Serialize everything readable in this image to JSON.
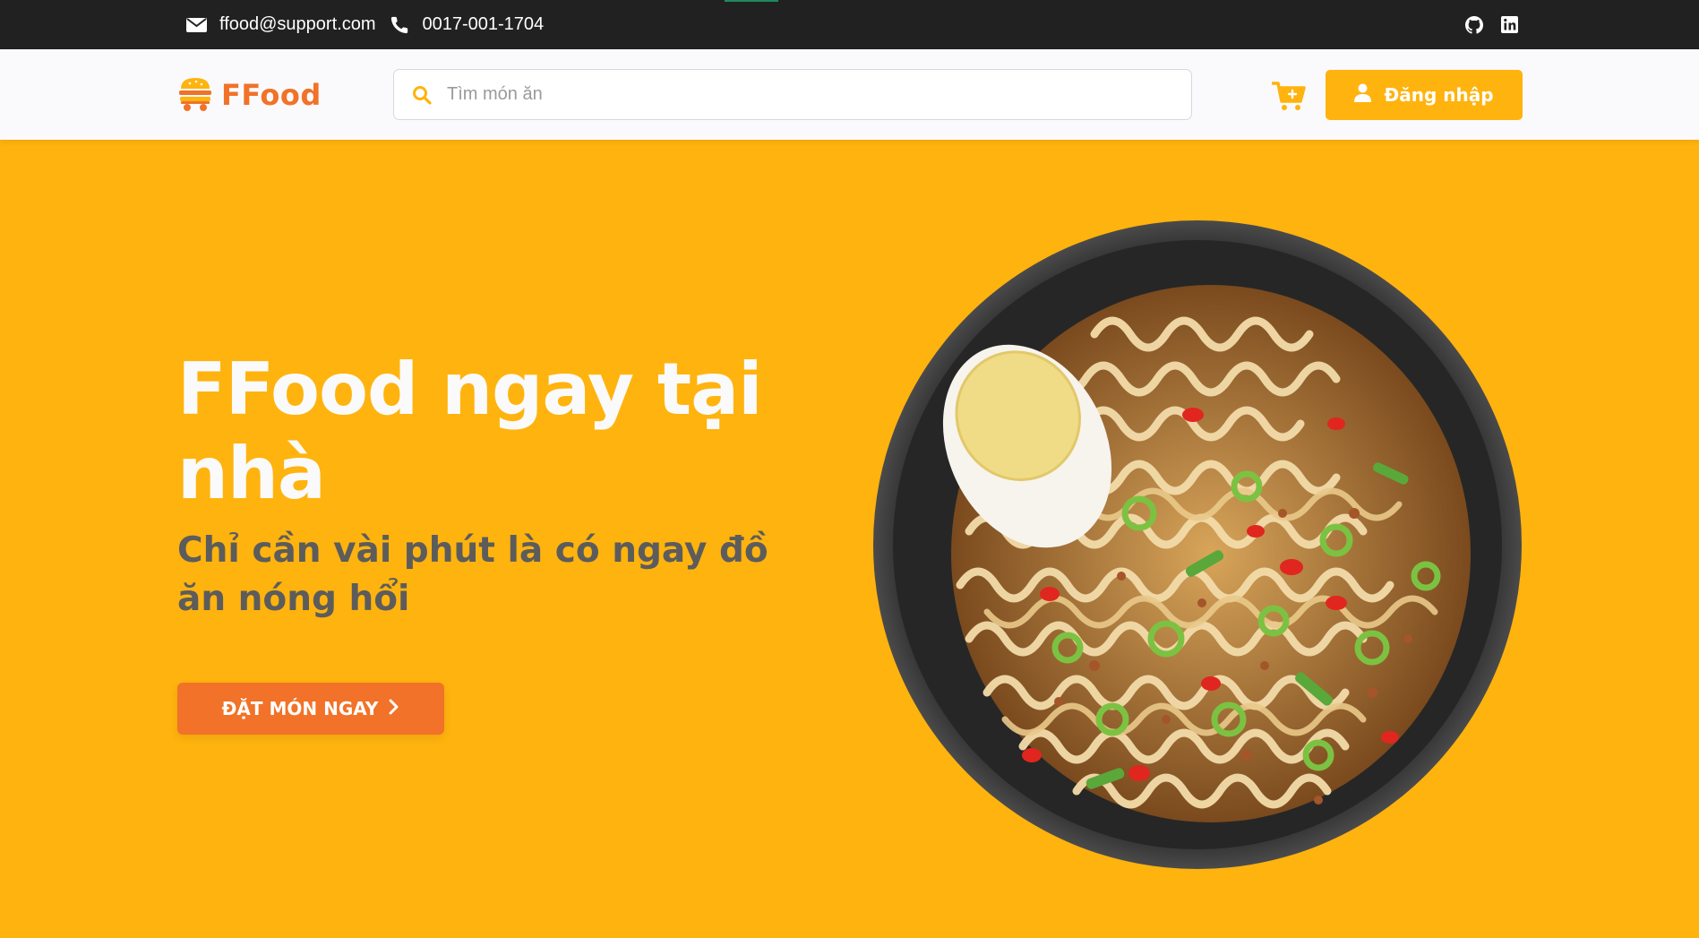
{
  "topbar": {
    "email": "ffood@support.com",
    "phone": "0017-001-1704",
    "icons": [
      "envelope-icon",
      "phone-icon",
      "github-icon",
      "linkedin-icon"
    ]
  },
  "navbar": {
    "brand_name": "FFood",
    "search_placeholder": "Tìm món ăn",
    "login_label": "Đăng nhập",
    "icons": [
      "burger-cart-logo-icon",
      "search-icon",
      "cart-icon",
      "user-icon"
    ]
  },
  "hero": {
    "title": "FFood ngay tại nhà",
    "subtitle": "Chỉ cần vài phút là có ngay đồ ăn nóng hổi",
    "cta_label": "ĐẶT MÓN NGAY",
    "image": "noodle-bowl-with-egg"
  },
  "colors": {
    "primary_yellow": "#FFB30E",
    "accent_orange": "#F17228",
    "topbar_bg": "#212121",
    "navbar_bg": "#FAFAFC",
    "subtitle_gray": "#5C5C5C"
  }
}
